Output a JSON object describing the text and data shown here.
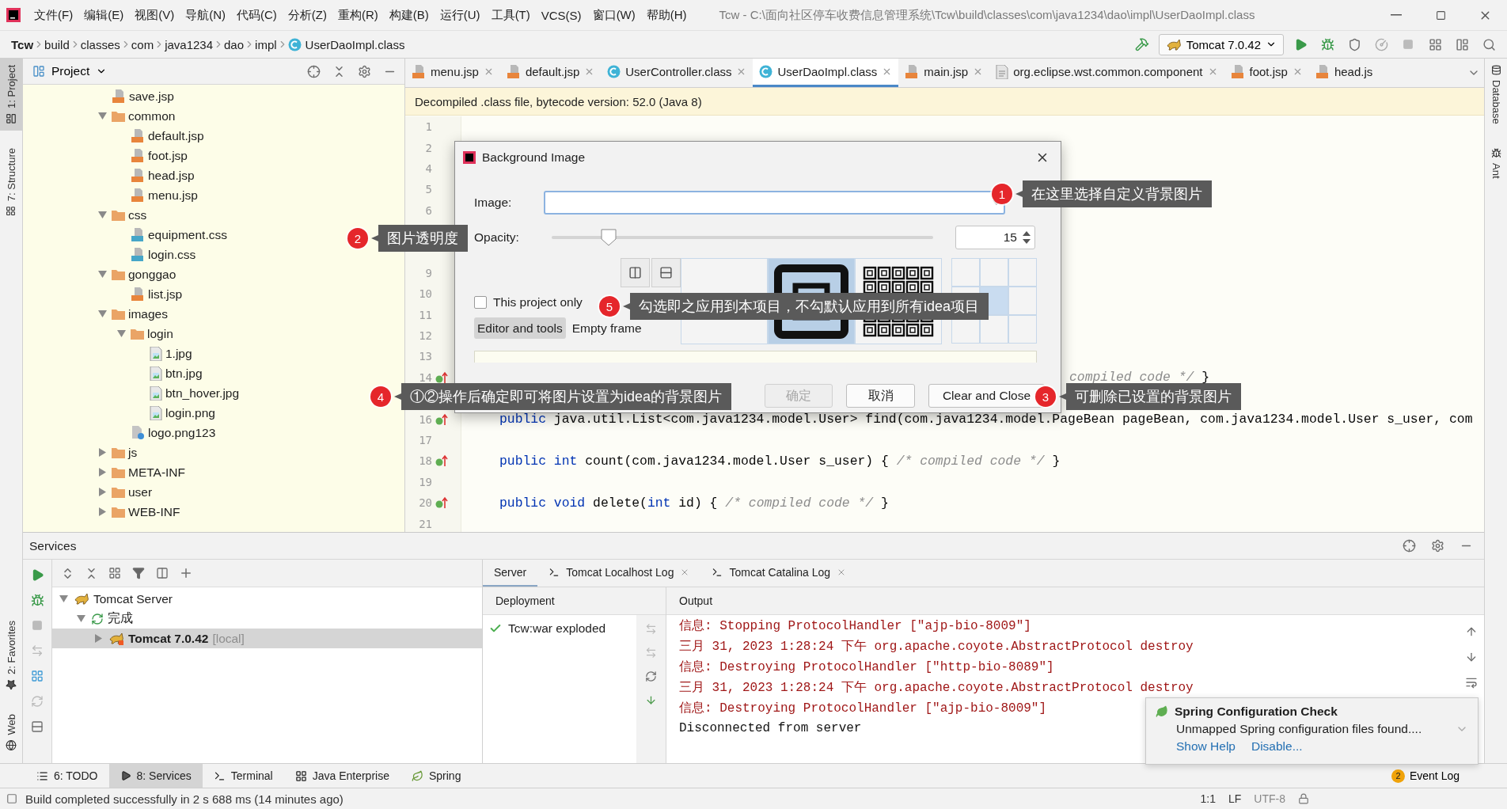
{
  "title_bar": {
    "menu": [
      "文件(F)",
      "编辑(E)",
      "视图(V)",
      "导航(N)",
      "代码(C)",
      "分析(Z)",
      "重构(R)",
      "构建(B)",
      "运行(U)",
      "工具(T)",
      "VCS(S)",
      "窗口(W)",
      "帮助(H)"
    ],
    "title": "Tcw - C:\\面向社区停车收费信息管理系统\\Tcw\\build\\classes\\com\\java1234\\dao\\impl\\UserDaoImpl.class"
  },
  "nav_bar": {
    "breadcrumbs": [
      {
        "label": "Tcw",
        "kind": "root"
      },
      {
        "label": "build",
        "kind": "dir"
      },
      {
        "label": "classes",
        "kind": "dir"
      },
      {
        "label": "com",
        "kind": "dir"
      },
      {
        "label": "java1234",
        "kind": "dir"
      },
      {
        "label": "dao",
        "kind": "dir"
      },
      {
        "label": "impl",
        "kind": "dir"
      },
      {
        "label": "UserDaoImpl.class",
        "kind": "class"
      }
    ],
    "run_config": "Tomcat 7.0.42"
  },
  "left_strip": {
    "top": [
      {
        "label": "1: Project",
        "kind": "project",
        "selected": true
      },
      {
        "label": "7: Structure",
        "kind": "structure",
        "selected": false
      }
    ],
    "bottom": [
      {
        "label": "2: Favorites",
        "kind": "favorites",
        "selected": false
      },
      {
        "label": "Web",
        "kind": "web",
        "selected": false
      }
    ]
  },
  "right_strip": [
    {
      "label": "Database",
      "kind": "database"
    },
    {
      "label": "Ant",
      "kind": "ant"
    }
  ],
  "project_panel": {
    "title": "Project",
    "tree": [
      {
        "label": "save.jsp",
        "kind": "jsp"
      },
      {
        "label": "common",
        "kind": "folder",
        "expanded": true,
        "children": [
          {
            "label": "default.jsp",
            "kind": "jsp"
          },
          {
            "label": "foot.jsp",
            "kind": "jsp"
          },
          {
            "label": "head.jsp",
            "kind": "jsp"
          },
          {
            "label": "menu.jsp",
            "kind": "jsp"
          }
        ]
      },
      {
        "label": "css",
        "kind": "folder",
        "expanded": true,
        "children": [
          {
            "label": "equipment.css",
            "kind": "css"
          },
          {
            "label": "login.css",
            "kind": "css"
          }
        ]
      },
      {
        "label": "gonggao",
        "kind": "folder",
        "expanded": true,
        "children": [
          {
            "label": "list.jsp",
            "kind": "jsp"
          }
        ]
      },
      {
        "label": "images",
        "kind": "folder",
        "expanded": true,
        "children": [
          {
            "label": "login",
            "kind": "folder",
            "expanded": true,
            "children": [
              {
                "label": "1.jpg",
                "kind": "image"
              },
              {
                "label": "btn.jpg",
                "kind": "image"
              },
              {
                "label": "btn_hover.jpg",
                "kind": "image"
              },
              {
                "label": "login.png",
                "kind": "image"
              }
            ]
          },
          {
            "label": "logo.png123",
            "kind": "unknown"
          }
        ]
      },
      {
        "label": "js",
        "kind": "folder",
        "expanded": false
      },
      {
        "label": "META-INF",
        "kind": "folder",
        "expanded": false
      },
      {
        "label": "user",
        "kind": "folder",
        "expanded": false
      },
      {
        "label": "WEB-INF",
        "kind": "folder",
        "expanded": false
      }
    ]
  },
  "editor": {
    "tabs": [
      {
        "label": "menu.jsp",
        "kind": "jsp",
        "selected": false,
        "closable": true
      },
      {
        "label": "default.jsp",
        "kind": "jsp",
        "selected": false,
        "closable": true
      },
      {
        "label": "UserController.class",
        "kind": "class",
        "selected": false,
        "closable": true
      },
      {
        "label": "UserDaoImpl.class",
        "kind": "class",
        "selected": true,
        "closable": true
      },
      {
        "label": "main.jsp",
        "kind": "jsp",
        "selected": false,
        "closable": true
      },
      {
        "label": "org.eclipse.wst.common.component",
        "kind": "file",
        "selected": false,
        "closable": true
      },
      {
        "label": "foot.jsp",
        "kind": "jsp",
        "selected": false,
        "closable": true
      },
      {
        "label": "head.js",
        "kind": "jsp",
        "selected": false,
        "closable": false
      }
    ],
    "notice": "Decompiled .class file, bytecode version: 52.0 (Java 8)",
    "line_groups": [
      [
        {
          "number": "1",
          "mark": false
        },
        {
          "number": "2",
          "mark": false
        },
        {
          "number": "4",
          "mark": false
        },
        {
          "number": "5",
          "mark": false
        },
        {
          "number": "6",
          "mark": false
        }
      ],
      [
        {
          "number": "9",
          "mark": false
        },
        {
          "number": "10",
          "mark": false
        },
        {
          "number": "11",
          "mark": false
        },
        {
          "number": "12",
          "mark": false
        },
        {
          "number": "13",
          "mark": false
        },
        {
          "number": "14",
          "mark": true,
          "kind": "partial",
          "tokens": [
            {
              "kind": "comment",
              "text": "compiled code */"
            },
            {
              "kind": "plain",
              "text": " }"
            }
          ]
        }
      ],
      [
        {
          "number": "16",
          "mark": true,
          "kind": "full",
          "tokens": [
            {
              "kind": "keyword",
              "text": "public"
            },
            {
              "kind": "plain",
              "text": " java.util.List<com.java1234.model.User> find(com.java1234.model.PageBean pageBean, com.java1234.model.User s_user, com"
            }
          ]
        },
        {
          "number": "17",
          "mark": false
        },
        {
          "number": "18",
          "mark": true,
          "kind": "full",
          "tokens": [
            {
              "kind": "keyword",
              "text": "public "
            },
            {
              "kind": "keyword",
              "text": "int"
            },
            {
              "kind": "plain",
              "text": " count(com.java1234.model.User s_user) { "
            },
            {
              "kind": "comment",
              "text": "/* compiled code */"
            },
            {
              "kind": "plain",
              "text": " }"
            }
          ]
        },
        {
          "number": "19",
          "mark": false
        },
        {
          "number": "20",
          "mark": true,
          "kind": "full",
          "tokens": [
            {
              "kind": "keyword",
              "text": "public "
            },
            {
              "kind": "keyword",
              "text": "void"
            },
            {
              "kind": "plain",
              "text": " delete("
            },
            {
              "kind": "keyword",
              "text": "int"
            },
            {
              "kind": "plain",
              "text": " id) { "
            },
            {
              "kind": "comment",
              "text": "/* compiled code */"
            },
            {
              "kind": "plain",
              "text": " }"
            }
          ]
        },
        {
          "number": "21",
          "mark": false
        }
      ]
    ]
  },
  "dialog": {
    "title": "Background Image",
    "image_label": "Image:",
    "opacity_label": "Opacity:",
    "opacity": {
      "level": 0.15,
      "value": "15"
    },
    "fill_modes": [
      {
        "kind": "center",
        "selected": false
      },
      {
        "kind": "scale",
        "selected": true
      },
      {
        "kind": "tile",
        "selected": false
      }
    ],
    "anchors": [
      {
        "selected": false
      },
      {
        "selected": false
      },
      {
        "selected": false
      },
      {
        "selected": false
      },
      {
        "selected": true
      },
      {
        "selected": false
      },
      {
        "selected": false
      },
      {
        "selected": false
      },
      {
        "selected": false
      }
    ],
    "this_project_only": {
      "label": "This project only",
      "checked": false
    },
    "targets": [
      {
        "label": "Editor and tools",
        "selected": true
      },
      {
        "label": "Empty frame",
        "selected": false
      }
    ],
    "buttons": [
      {
        "label": "确定",
        "disabled": true
      },
      {
        "label": "取消",
        "disabled": false
      },
      {
        "label": "Clear and Close",
        "disabled": false
      }
    ]
  },
  "callouts": [
    {
      "number": "1",
      "text": "在这里选择自定义背景图片"
    },
    {
      "number": "2",
      "text": "图片透明度"
    },
    {
      "number": "5",
      "text": "勾选即之应用到本项目，不勾默认应用到所有idea项目"
    },
    {
      "number": "4",
      "text": "①②操作后确定即可将图片设置为idea的背景图片"
    },
    {
      "number": "3",
      "text": "可删除已设置的背景图片"
    }
  ],
  "services": {
    "title": "Services",
    "tree": [
      {
        "label": "Tomcat Server",
        "kind": "server",
        "expanded": true,
        "selected": false,
        "children": [
          {
            "label": "完成",
            "kind": "status",
            "expanded": true,
            "selected": false,
            "children": [
              {
                "label": "Tomcat 7.0.42",
                "suffix": "[local]",
                "kind": "instance",
                "expanded": false,
                "selected": true
              }
            ]
          }
        ]
      }
    ],
    "tabs": [
      {
        "label": "Server",
        "selected": true,
        "closable": false
      },
      {
        "label": "Tomcat Localhost Log",
        "selected": false,
        "closable": true
      },
      {
        "label": "Tomcat Catalina Log",
        "selected": false,
        "closable": true
      }
    ],
    "deployment_header": "Deployment",
    "output_header": "Output",
    "deployments": [
      "Tcw:war exploded"
    ],
    "output": [
      {
        "kind": "info",
        "text": "信息: Stopping ProtocolHandler [\"ajp-bio-8009\"]"
      },
      {
        "kind": "info",
        "text": "三月 31, 2023 1:28:24 下午 org.apache.coyote.AbstractProtocol destroy"
      },
      {
        "kind": "info",
        "text": "信息: Destroying ProtocolHandler [\"http-bio-8089\"]"
      },
      {
        "kind": "info",
        "text": "三月 31, 2023 1:28:24 下午 org.apache.coyote.AbstractProtocol destroy"
      },
      {
        "kind": "info",
        "text": "信息: Destroying ProtocolHandler [\"ajp-bio-8009\"]"
      },
      {
        "kind": "plain",
        "text": "Disconnected from server"
      }
    ]
  },
  "notification": {
    "title": "Spring Configuration Check",
    "body": "Unmapped Spring configuration files found....",
    "links": [
      "Show Help",
      "Disable..."
    ]
  },
  "tool_tabs": [
    {
      "label": "6: TODO",
      "kind": "todo",
      "selected": false
    },
    {
      "label": "8: Services",
      "kind": "services",
      "selected": true
    },
    {
      "label": "Terminal",
      "kind": "terminal",
      "selected": false
    },
    {
      "label": "Java Enterprise",
      "kind": "enterprise",
      "selected": false
    },
    {
      "label": "Spring",
      "kind": "spring",
      "selected": false
    }
  ],
  "event_log": {
    "count": "2",
    "label": "Event Log"
  },
  "status_bar": {
    "message": "Build completed successfully in 2 s 688 ms (14 minutes ago)",
    "position": "1:1",
    "line_separator": "LF",
    "encoding": "UTF-8"
  }
}
